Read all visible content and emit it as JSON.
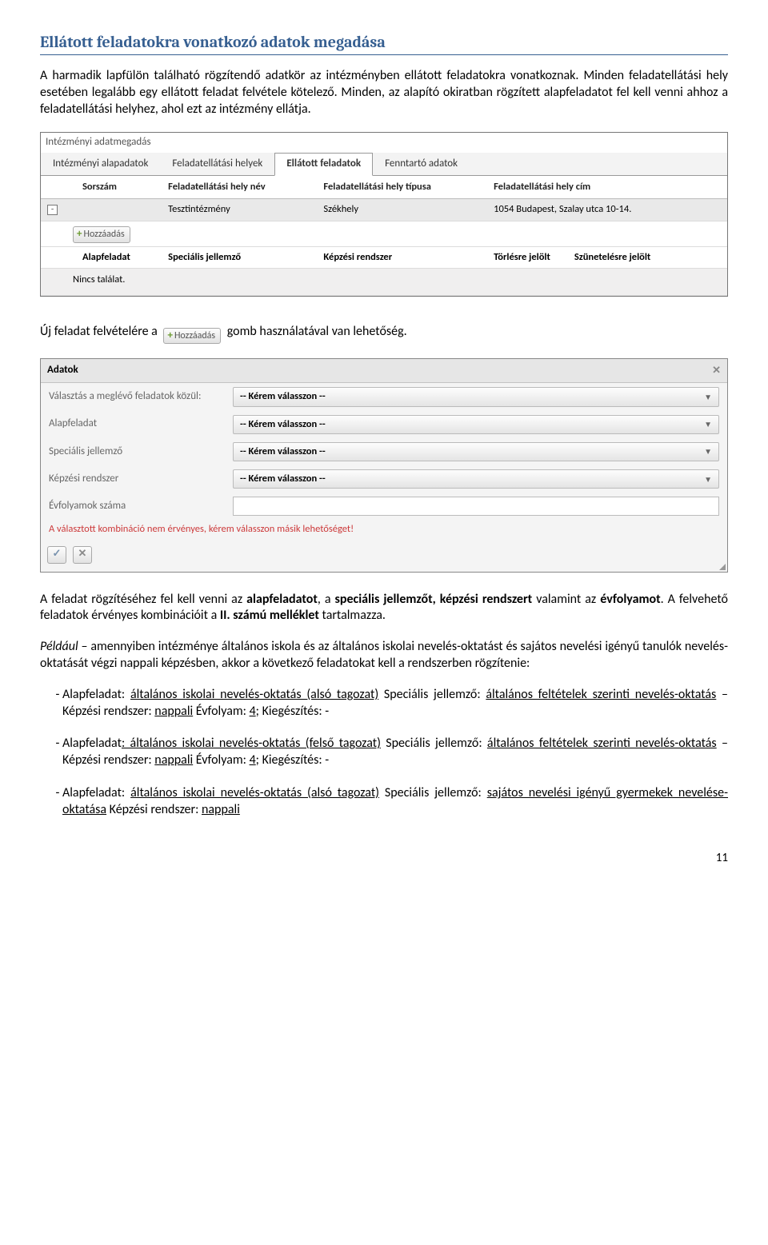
{
  "heading": "Ellátott feladatokra vonatkozó adatok megadása",
  "para1": "A harmadik lapfülön található rögzítendő adatkör az intézményben ellátott feladatokra vonatkoznak. Minden feladatellátási hely esetében legalább egy ellátott feladat felvétele kötelező. Minden, az alapító okiratban rögzített alapfeladatot fel kell venni ahhoz a feladatellátási helyhez, ahol ezt az intézmény ellátja.",
  "screenshot1": {
    "breadcrumb": "Intézményi adatmegadás",
    "tabs": [
      "Intézményi alapadatok",
      "Feladatellátási helyek",
      "Ellátott feladatok",
      "Fenntartó adatok"
    ],
    "active_tab": "Ellátott feladatok",
    "cols": [
      "Sorszám",
      "Feladatellátási hely név",
      "Feladatellátási hely típusa",
      "Feladatellátási hely cím"
    ],
    "row": [
      "",
      "Tesztintézmény",
      "Székhely",
      "1054 Budapest, Szalay utca 10-14."
    ],
    "add_btn": "Hozzáadás",
    "subcols": [
      "Alapfeladat",
      "Speciális jellemző",
      "Képzési rendszer",
      "Törlésre jelölt",
      "Szünetelésre jelölt"
    ],
    "empty": "Nincs találat."
  },
  "sentence2_a": "Új feladat felvételére a ",
  "sentence2_b": " gomb használatával van lehetőség.",
  "modal": {
    "title": "Adatok",
    "rows": [
      {
        "label": "Választás a meglévő feladatok közül:",
        "value": "-- Kérem válasszon --"
      },
      {
        "label": "Alapfeladat",
        "value": "-- Kérem válasszon --"
      },
      {
        "label": "Speciális jellemző",
        "value": "-- Kérem válasszon --"
      },
      {
        "label": "Képzési rendszer",
        "value": "-- Kérem válasszon --"
      },
      {
        "label": "Évfolyamok száma",
        "value": ""
      }
    ],
    "error": "A választott kombináció nem érvényes, kérem válasszon másik lehetőséget!"
  },
  "para3": "A feladat rögzítéséhez fel kell venni az alapfeladatot, a speciális jellemzőt, képzési rendszert valamint az évfolyamot. A felvehető feladatok érvényes kombinációit a II. számú melléklet tartalmazza.",
  "para4": "Például – amennyiben intézménye általános iskola és az általános iskolai nevelés-oktatást és sajátos nevelési igényű tanulók nevelés-oktatását végzi nappali képzésben, akkor a következő feladatokat kell a rendszerben rögzítenie:",
  "items": [
    "Alapfeladat: általános iskolai nevelés-oktatás (alsó tagozat) Speciális jellemző: általános feltételek szerinti nevelés-oktatás – Képzési rendszer: nappali Évfolyam: 4; Kiegészítés: -",
    "Alapfeladat: általános iskolai nevelés-oktatás (felső tagozat) Speciális jellemző: általános feltételek szerinti nevelés-oktatás – Képzési rendszer: nappali Évfolyam: 4; Kiegészítés: -",
    "Alapfeladat: általános iskolai nevelés-oktatás (alsó tagozat) Speciális jellemző: sajátos nevelési igényű gyermekek nevelése-oktatása Képzési rendszer: nappali"
  ],
  "page": "11"
}
